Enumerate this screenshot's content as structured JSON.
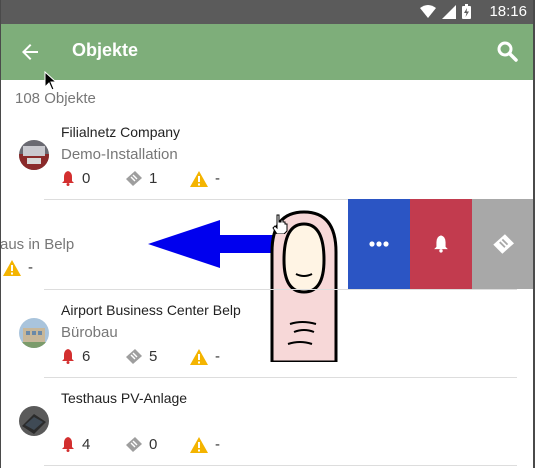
{
  "status_bar": {
    "time": "18:16"
  },
  "app_bar": {
    "title": "Objekte"
  },
  "list": {
    "count_label": "108 Objekte",
    "items": [
      {
        "name": "Filialnetz Company",
        "subtitle": "Demo-Installation",
        "alarms": "0",
        "tickets": "1",
        "warnings": "-"
      },
      {
        "name": "",
        "subtitle": "aus in Belp",
        "warnings": "-"
      },
      {
        "name": "Airport Business Center Belp",
        "subtitle": "Bürobau",
        "alarms": "6",
        "tickets": "5",
        "warnings": "-"
      },
      {
        "name": "Testhaus PV-Anlage",
        "subtitle": "",
        "alarms": "4",
        "tickets": "0",
        "warnings": "-"
      }
    ]
  },
  "swipe_actions": [
    {
      "icon": "more-dots-icon",
      "color": "#2b55c4"
    },
    {
      "icon": "bell-icon",
      "color": "#c23b4e"
    },
    {
      "icon": "ticket-icon",
      "color": "#a8a8a8"
    }
  ],
  "colors": {
    "app_bar": "#7eae7a",
    "status_bar": "#5b5b5b",
    "alarm": "#d32f2f",
    "ticket": "#9e9e9e",
    "warning": "#f4b400",
    "swipe_arrow": "#0000ee"
  }
}
